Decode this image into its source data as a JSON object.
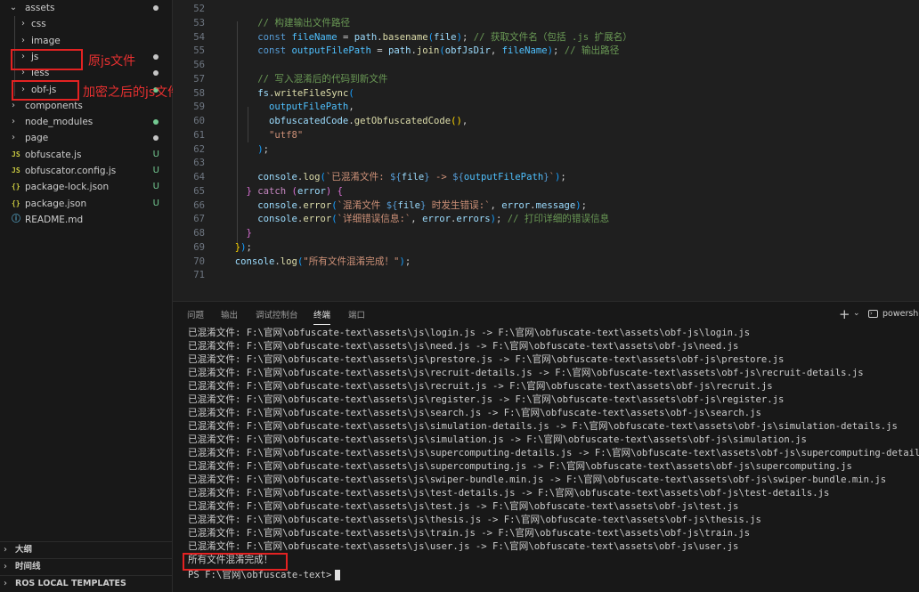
{
  "sidebar": {
    "tree": [
      {
        "label": "assets",
        "kind": "folder-open",
        "depth": 0,
        "dot": "#c5c5c5"
      },
      {
        "label": "css",
        "kind": "folder",
        "depth": 1
      },
      {
        "label": "image",
        "kind": "folder",
        "depth": 1
      },
      {
        "label": "js",
        "kind": "folder",
        "depth": 1,
        "dot": "#c5c5c5"
      },
      {
        "label": "less",
        "kind": "folder",
        "depth": 1,
        "dot": "#c5c5c5"
      },
      {
        "label": "obf-js",
        "kind": "folder",
        "depth": 1,
        "dot": "#73c991"
      },
      {
        "label": "components",
        "kind": "folder",
        "depth": 0
      },
      {
        "label": "node_modules",
        "kind": "folder",
        "depth": 0,
        "dot": "#73c991"
      },
      {
        "label": "page",
        "kind": "folder",
        "depth": 0,
        "dot": "#c5c5c5"
      },
      {
        "label": "obfuscate.js",
        "kind": "file",
        "icon": "JS",
        "badge": "U"
      },
      {
        "label": "obfuscator.config.js",
        "kind": "file",
        "icon": "JS",
        "badge": "U"
      },
      {
        "label": "package-lock.json",
        "kind": "file",
        "icon": "{}",
        "badge": "U"
      },
      {
        "label": "package.json",
        "kind": "file",
        "icon": "{}",
        "badge": "U"
      },
      {
        "label": "README.md",
        "kind": "file",
        "icon": "ⓘ",
        "badge": ""
      }
    ],
    "annotations": {
      "js_note": "原js文件",
      "obf_note": "加密之后的js文件"
    },
    "sections": [
      "大纲",
      "时间线",
      "ROS LOCAL TEMPLATES"
    ]
  },
  "editor": {
    "lines": [
      {
        "n": "52",
        "t": []
      },
      {
        "n": "53",
        "t": [
          [
            "cm",
            "      // 构建输出文件路径"
          ]
        ]
      },
      {
        "n": "54",
        "t": [
          [
            "kw",
            "      const "
          ],
          [
            "cst",
            "fileName"
          ],
          [
            "pl",
            " = "
          ],
          [
            "var",
            "path"
          ],
          [
            "pl",
            "."
          ],
          [
            "fn",
            "basename"
          ],
          [
            "b3",
            "("
          ],
          [
            "var",
            "file"
          ],
          [
            "b3",
            ")"
          ],
          [
            "pl",
            "; "
          ],
          [
            "cm",
            "// 获取文件名（包括 .js 扩展名）"
          ]
        ]
      },
      {
        "n": "55",
        "t": [
          [
            "kw",
            "      const "
          ],
          [
            "cst",
            "outputFilePath"
          ],
          [
            "pl",
            " = "
          ],
          [
            "var",
            "path"
          ],
          [
            "pl",
            "."
          ],
          [
            "fn",
            "join"
          ],
          [
            "b3",
            "("
          ],
          [
            "var",
            "obfJsDir"
          ],
          [
            "pl",
            ", "
          ],
          [
            "cst",
            "fileName"
          ],
          [
            "b3",
            ")"
          ],
          [
            "pl",
            "; "
          ],
          [
            "cm",
            "// 输出路径"
          ]
        ]
      },
      {
        "n": "56",
        "t": []
      },
      {
        "n": "57",
        "t": [
          [
            "cm",
            "      // 写入混淆后的代码到新文件"
          ]
        ]
      },
      {
        "n": "58",
        "t": [
          [
            "var",
            "      fs"
          ],
          [
            "pl",
            "."
          ],
          [
            "fn",
            "writeFileSync"
          ],
          [
            "b3",
            "("
          ]
        ]
      },
      {
        "n": "59",
        "t": [
          [
            "cst",
            "        outputFilePath"
          ],
          [
            "pl",
            ","
          ]
        ]
      },
      {
        "n": "60",
        "t": [
          [
            "var",
            "        obfuscatedCode"
          ],
          [
            "pl",
            "."
          ],
          [
            "fn",
            "getObfuscatedCode"
          ],
          [
            "b1",
            "()"
          ],
          [
            "pl",
            ","
          ]
        ]
      },
      {
        "n": "61",
        "t": [
          [
            "str",
            "        \"utf8\""
          ]
        ]
      },
      {
        "n": "62",
        "t": [
          [
            "b3",
            "      )"
          ],
          [
            "pl",
            ";"
          ]
        ]
      },
      {
        "n": "63",
        "t": []
      },
      {
        "n": "64",
        "t": [
          [
            "var",
            "      console"
          ],
          [
            "pl",
            "."
          ],
          [
            "fn",
            "log"
          ],
          [
            "b3",
            "("
          ],
          [
            "str",
            "`已混淆文件: "
          ],
          [
            "tpl",
            "${"
          ],
          [
            "var",
            "file"
          ],
          [
            "tpl",
            "}"
          ],
          [
            "str",
            " -> "
          ],
          [
            "tpl",
            "${"
          ],
          [
            "cst",
            "outputFilePath"
          ],
          [
            "tpl",
            "}"
          ],
          [
            "str",
            "`"
          ],
          [
            "b3",
            ")"
          ],
          [
            "pl",
            ";"
          ]
        ]
      },
      {
        "n": "65",
        "t": [
          [
            "b2",
            "    }"
          ],
          [
            "ctl",
            " catch "
          ],
          [
            "b2",
            "("
          ],
          [
            "var",
            "error"
          ],
          [
            "b2",
            ")"
          ],
          [
            "b2",
            " {"
          ]
        ]
      },
      {
        "n": "66",
        "t": [
          [
            "var",
            "      console"
          ],
          [
            "pl",
            "."
          ],
          [
            "fn",
            "error"
          ],
          [
            "b3",
            "("
          ],
          [
            "str",
            "`混淆文件 "
          ],
          [
            "tpl",
            "${"
          ],
          [
            "var",
            "file"
          ],
          [
            "tpl",
            "}"
          ],
          [
            "str",
            " 时发生错误:`"
          ],
          [
            "pl",
            ", "
          ],
          [
            "var",
            "error"
          ],
          [
            "pl",
            "."
          ],
          [
            "var",
            "message"
          ],
          [
            "b3",
            ")"
          ],
          [
            "pl",
            ";"
          ]
        ]
      },
      {
        "n": "67",
        "t": [
          [
            "var",
            "      console"
          ],
          [
            "pl",
            "."
          ],
          [
            "fn",
            "error"
          ],
          [
            "b3",
            "("
          ],
          [
            "str",
            "`详细错误信息:`"
          ],
          [
            "pl",
            ", "
          ],
          [
            "var",
            "error"
          ],
          [
            "pl",
            "."
          ],
          [
            "var",
            "errors"
          ],
          [
            "b3",
            ")"
          ],
          [
            "pl",
            "; "
          ],
          [
            "cm",
            "// 打印详细的错误信息"
          ]
        ]
      },
      {
        "n": "68",
        "t": [
          [
            "b2",
            "    }"
          ]
        ]
      },
      {
        "n": "69",
        "t": [
          [
            "b1",
            "  }"
          ],
          [
            "b3",
            ")"
          ],
          [
            "pl",
            ";"
          ]
        ]
      },
      {
        "n": "70",
        "t": [
          [
            "var",
            "  console"
          ],
          [
            "pl",
            "."
          ],
          [
            "fn",
            "log"
          ],
          [
            "b3",
            "("
          ],
          [
            "str",
            "\"所有文件混淆完成！\""
          ],
          [
            "b3",
            ")"
          ],
          [
            "pl",
            ";"
          ]
        ]
      },
      {
        "n": "71",
        "t": []
      }
    ]
  },
  "panel": {
    "tabs": [
      "问题",
      "输出",
      "调试控制台",
      "终端",
      "端口"
    ],
    "active_tab": "终端",
    "shell": "powershell",
    "lines": [
      "已混淆文件: F:\\官网\\obfuscate-text\\assets\\js\\login.js -> F:\\官网\\obfuscate-text\\assets\\obf-js\\login.js",
      "已混淆文件: F:\\官网\\obfuscate-text\\assets\\js\\need.js -> F:\\官网\\obfuscate-text\\assets\\obf-js\\need.js",
      "已混淆文件: F:\\官网\\obfuscate-text\\assets\\js\\prestore.js -> F:\\官网\\obfuscate-text\\assets\\obf-js\\prestore.js",
      "已混淆文件: F:\\官网\\obfuscate-text\\assets\\js\\recruit-details.js -> F:\\官网\\obfuscate-text\\assets\\obf-js\\recruit-details.js",
      "已混淆文件: F:\\官网\\obfuscate-text\\assets\\js\\recruit.js -> F:\\官网\\obfuscate-text\\assets\\obf-js\\recruit.js",
      "已混淆文件: F:\\官网\\obfuscate-text\\assets\\js\\register.js -> F:\\官网\\obfuscate-text\\assets\\obf-js\\register.js",
      "已混淆文件: F:\\官网\\obfuscate-text\\assets\\js\\search.js -> F:\\官网\\obfuscate-text\\assets\\obf-js\\search.js",
      "已混淆文件: F:\\官网\\obfuscate-text\\assets\\js\\simulation-details.js -> F:\\官网\\obfuscate-text\\assets\\obf-js\\simulation-details.js",
      "已混淆文件: F:\\官网\\obfuscate-text\\assets\\js\\simulation.js -> F:\\官网\\obfuscate-text\\assets\\obf-js\\simulation.js",
      "已混淆文件: F:\\官网\\obfuscate-text\\assets\\js\\supercomputing-details.js -> F:\\官网\\obfuscate-text\\assets\\obf-js\\supercomputing-details.js",
      "已混淆文件: F:\\官网\\obfuscate-text\\assets\\js\\supercomputing.js -> F:\\官网\\obfuscate-text\\assets\\obf-js\\supercomputing.js",
      "已混淆文件: F:\\官网\\obfuscate-text\\assets\\js\\swiper-bundle.min.js -> F:\\官网\\obfuscate-text\\assets\\obf-js\\swiper-bundle.min.js",
      "已混淆文件: F:\\官网\\obfuscate-text\\assets\\js\\test-details.js -> F:\\官网\\obfuscate-text\\assets\\obf-js\\test-details.js",
      "已混淆文件: F:\\官网\\obfuscate-text\\assets\\js\\test.js -> F:\\官网\\obfuscate-text\\assets\\obf-js\\test.js",
      "已混淆文件: F:\\官网\\obfuscate-text\\assets\\js\\thesis.js -> F:\\官网\\obfuscate-text\\assets\\obf-js\\thesis.js",
      "已混淆文件: F:\\官网\\obfuscate-text\\assets\\js\\train.js -> F:\\官网\\obfuscate-text\\assets\\obf-js\\train.js",
      "已混淆文件: F:\\官网\\obfuscate-text\\assets\\js\\user.js -> F:\\官网\\obfuscate-text\\assets\\obf-js\\user.js",
      "所有文件混淆完成！"
    ],
    "prompt": "PS F:\\官网\\obfuscate-text>"
  }
}
